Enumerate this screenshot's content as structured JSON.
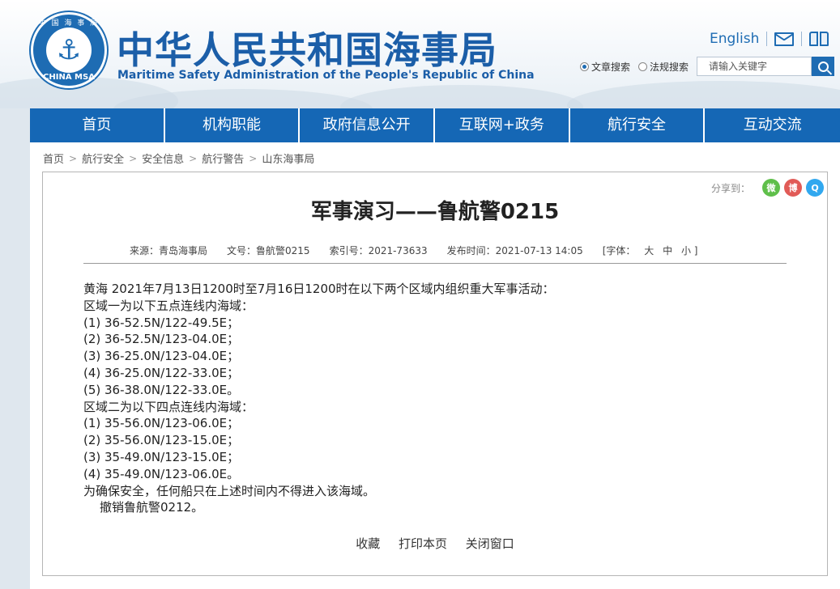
{
  "header": {
    "logo_cn": "中 国 海 事 局",
    "logo_en": "CHINA MSA",
    "title_cn": "中华人民共和国海事局",
    "title_en": "Maritime Safety Administration of the People's Republic of China",
    "english_link": "English",
    "icons": [
      "mail-icon",
      "book-icon",
      "search-icon",
      "anchor-icon"
    ]
  },
  "search": {
    "option_article": "文章搜索",
    "option_law": "法规搜索",
    "placeholder": "请输入关键字"
  },
  "nav": {
    "items": [
      "首页",
      "机构职能",
      "政府信息公开",
      "互联网+政务",
      "航行安全",
      "互动交流"
    ]
  },
  "breadcrumb": [
    "首页",
    "航行安全",
    "安全信息",
    "航行警告",
    "山东海事局"
  ],
  "share": {
    "label": "分享到：",
    "wechat": "微",
    "weibo": "博",
    "qq": "Q"
  },
  "article": {
    "title": "军事演习——鲁航警0215",
    "source": "来源：青岛海事局",
    "doc_no": "文号：鲁航警0215",
    "index_no": "索引号：2021-73633",
    "publish_time": "发布时间：2021-07-13 14:05",
    "font_label": "[字体：",
    "font_large": "大",
    "font_medium": "中",
    "font_small": "小 ]",
    "lines": [
      "黄海  2021年7月13日1200时至7月16日1200时在以下两个区域内组织重大军事活动：",
      "区域一为以下五点连线内海域：",
      "(1) 36-52.5N/122-49.5E；",
      "(2) 36-52.5N/123-04.0E；",
      "(3) 36-25.0N/123-04.0E；",
      "(4) 36-25.0N/122-33.0E；",
      "(5) 36-38.0N/122-33.0E。",
      "区域二为以下四点连线内海域：",
      "(1) 35-56.0N/123-06.0E；",
      "(2) 35-56.0N/123-15.0E；",
      "(3) 35-49.0N/123-15.0E；",
      "(4) 35-49.0N/123-06.0E。",
      "为确保安全，任何船只在上述时间内不得进入该海域。",
      "撤销鲁航警0212。"
    ],
    "actions": [
      "收藏",
      "打印本页",
      "关闭窗口"
    ]
  }
}
